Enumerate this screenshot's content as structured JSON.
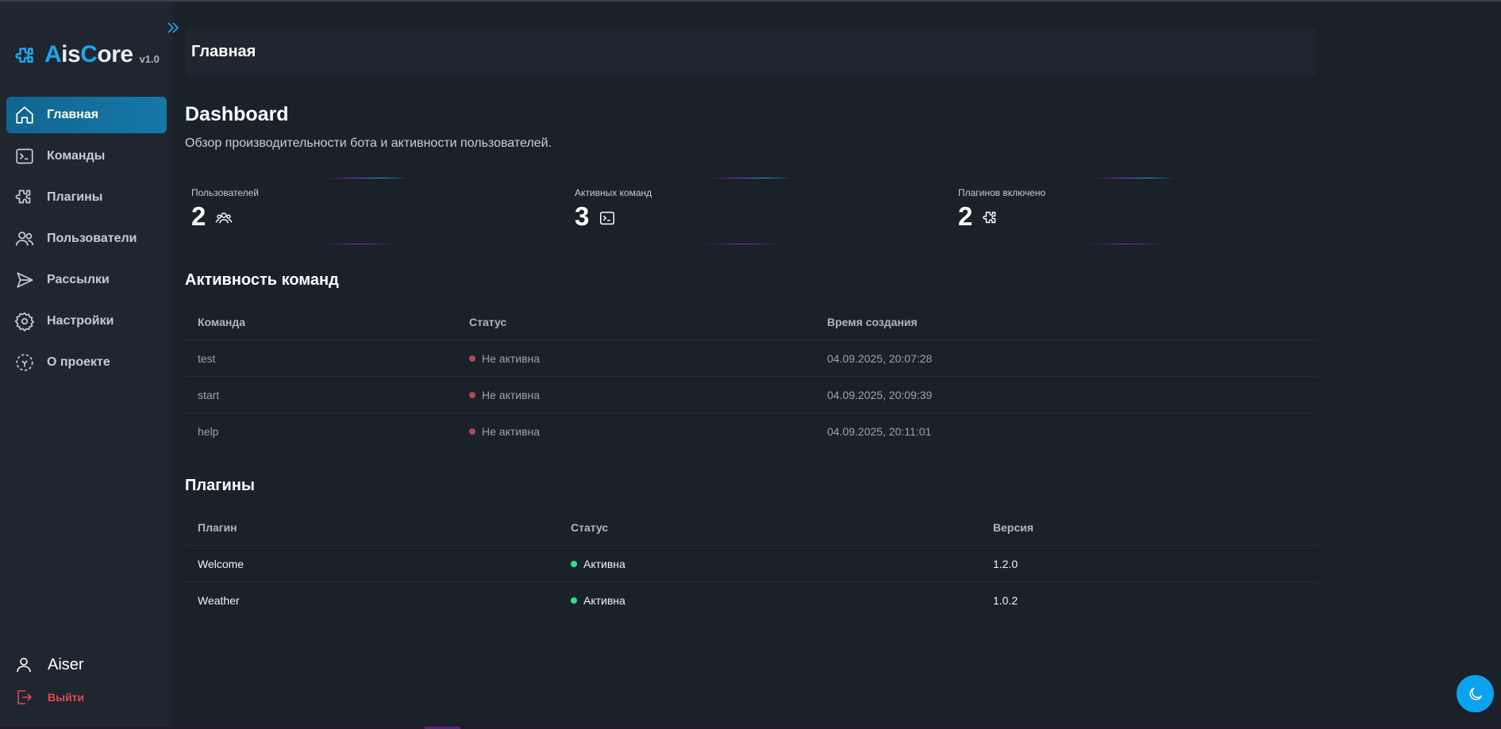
{
  "brand": {
    "name_accent_1": "A",
    "name_1": "is",
    "name_accent_2": "C",
    "name_2": "ore",
    "version": "v1.0"
  },
  "sidebar": {
    "items": [
      {
        "label": "Главная",
        "icon": "home-icon",
        "active": true
      },
      {
        "label": "Команды",
        "icon": "terminal-icon"
      },
      {
        "label": "Плагины",
        "icon": "puzzle-icon"
      },
      {
        "label": "Пользователи",
        "icon": "users-icon"
      },
      {
        "label": "Рассылки",
        "icon": "send-icon"
      },
      {
        "label": "Настройки",
        "icon": "gear-icon"
      },
      {
        "label": "О проекте",
        "icon": "about-icon"
      }
    ],
    "user": {
      "name": "Aiser",
      "icon": "user-icon"
    },
    "logout": {
      "label": "Выйти",
      "icon": "logout-icon"
    }
  },
  "header": {
    "title": "Главная"
  },
  "page": {
    "title": "Dashboard",
    "subtitle": "Обзор производительности бота и активности пользователей."
  },
  "stats": [
    {
      "label": "Пользователей",
      "value": "2",
      "icon": "users-icon"
    },
    {
      "label": "Активных команд",
      "value": "3",
      "icon": "terminal-icon"
    },
    {
      "label": "Плагинов включено",
      "value": "2",
      "icon": "puzzle-icon"
    }
  ],
  "commands": {
    "title": "Активность команд",
    "columns": [
      "Команда",
      "Статус",
      "Время создания"
    ],
    "rows": [
      {
        "name": "test",
        "status": "Не активна",
        "created": "04.09.2025, 20:07:28"
      },
      {
        "name": "start",
        "status": "Не активна",
        "created": "04.09.2025, 20:09:39"
      },
      {
        "name": "help",
        "status": "Не активна",
        "created": "04.09.2025, 20:11:01"
      }
    ]
  },
  "plugins": {
    "title": "Плагины",
    "columns": [
      "Плагин",
      "Статус",
      "Версия"
    ],
    "rows": [
      {
        "name": "Welcome",
        "status": "Активна",
        "version": "1.2.0"
      },
      {
        "name": "Weather",
        "status": "Активна",
        "version": "1.0.2"
      }
    ]
  },
  "colors": {
    "accent": "#1ba6e8",
    "active_nav": "#1578a8",
    "status_inactive": "#b0485a",
    "status_active": "#2ee08e",
    "logout": "#e2494f"
  },
  "theme_toggle": {
    "icon": "moon-icon"
  },
  "collapse": {
    "icon": "chevrons-right-icon"
  }
}
